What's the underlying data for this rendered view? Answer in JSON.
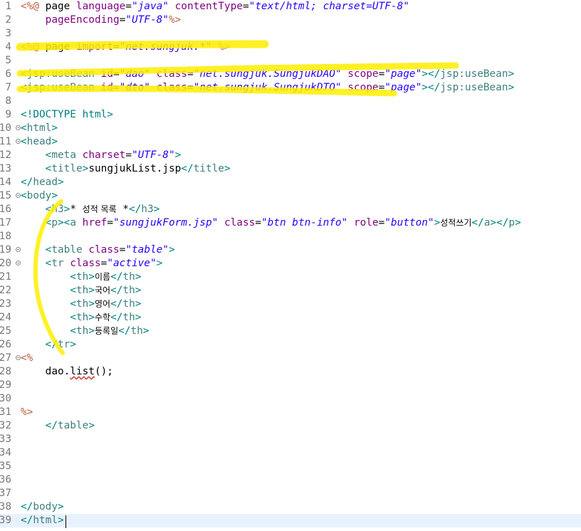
{
  "editor": {
    "current_line": 39,
    "lines": [
      {
        "num": "1",
        "fold": false,
        "tokens": [
          {
            "t": "<%@",
            "c": "jsp"
          },
          {
            "t": " page ",
            "c": "text"
          },
          {
            "t": "language",
            "c": "attr"
          },
          {
            "t": "=",
            "c": "text"
          },
          {
            "t": "\"java\"",
            "c": "val"
          },
          {
            "t": " ",
            "c": "text"
          },
          {
            "t": "contentType",
            "c": "attr"
          },
          {
            "t": "=",
            "c": "text"
          },
          {
            "t": "\"text/html; charset=UTF-8\"",
            "c": "val"
          }
        ]
      },
      {
        "num": "2",
        "fold": false,
        "tokens": [
          {
            "t": "    ",
            "c": "text"
          },
          {
            "t": "pageEncoding",
            "c": "attr"
          },
          {
            "t": "=",
            "c": "text"
          },
          {
            "t": "\"UTF-8\"",
            "c": "val"
          },
          {
            "t": "%>",
            "c": "jsp"
          }
        ]
      },
      {
        "num": "3",
        "fold": false,
        "tokens": []
      },
      {
        "num": "4",
        "fold": false,
        "tokens": [
          {
            "t": "<%@",
            "c": "jsp"
          },
          {
            "t": " page ",
            "c": "text"
          },
          {
            "t": "import",
            "c": "attr"
          },
          {
            "t": "=",
            "c": "text"
          },
          {
            "t": "\"net.sungjuk.*\"",
            "c": "val"
          },
          {
            "t": " ",
            "c": "text"
          },
          {
            "t": "%>",
            "c": "jsp"
          }
        ]
      },
      {
        "num": "5",
        "fold": false,
        "tokens": []
      },
      {
        "num": "6",
        "fold": false,
        "tokens": [
          {
            "t": "<",
            "c": "delim"
          },
          {
            "t": "jsp:useBean",
            "c": "tag"
          },
          {
            "t": " ",
            "c": "text"
          },
          {
            "t": "id",
            "c": "attr"
          },
          {
            "t": "=",
            "c": "text"
          },
          {
            "t": "\"dao\"",
            "c": "val"
          },
          {
            "t": " ",
            "c": "text"
          },
          {
            "t": "class",
            "c": "attr"
          },
          {
            "t": "=",
            "c": "text"
          },
          {
            "t": "\"net.sungjuk.SungjukDAO\"",
            "c": "val"
          },
          {
            "t": " ",
            "c": "text"
          },
          {
            "t": "scope",
            "c": "attr"
          },
          {
            "t": "=",
            "c": "text"
          },
          {
            "t": "\"page\"",
            "c": "val"
          },
          {
            "t": "></",
            "c": "delim"
          },
          {
            "t": "jsp:useBean",
            "c": "tag"
          },
          {
            "t": ">",
            "c": "delim"
          }
        ]
      },
      {
        "num": "7",
        "fold": false,
        "tokens": [
          {
            "t": "<",
            "c": "delim"
          },
          {
            "t": "jsp:useBean",
            "c": "tag"
          },
          {
            "t": " ",
            "c": "text"
          },
          {
            "t": "id",
            "c": "attr"
          },
          {
            "t": "=",
            "c": "text"
          },
          {
            "t": "\"dto\"",
            "c": "val"
          },
          {
            "t": " ",
            "c": "text"
          },
          {
            "t": "class",
            "c": "attr"
          },
          {
            "t": "=",
            "c": "text"
          },
          {
            "t": "\"net.sungjuk.SungjukDTO\"",
            "c": "val"
          },
          {
            "t": " ",
            "c": "text"
          },
          {
            "t": "scope",
            "c": "attr"
          },
          {
            "t": "=",
            "c": "text"
          },
          {
            "t": "\"page\"",
            "c": "val"
          },
          {
            "t": "></",
            "c": "delim"
          },
          {
            "t": "jsp:useBean",
            "c": "tag"
          },
          {
            "t": ">",
            "c": "delim"
          }
        ]
      },
      {
        "num": "8",
        "fold": false,
        "tokens": []
      },
      {
        "num": "9",
        "fold": false,
        "tokens": [
          {
            "t": "<!DOCTYPE html>",
            "c": "doctype"
          }
        ]
      },
      {
        "num": "10",
        "fold": true,
        "tokens": [
          {
            "t": "<",
            "c": "delim"
          },
          {
            "t": "html",
            "c": "tag"
          },
          {
            "t": ">",
            "c": "delim"
          }
        ]
      },
      {
        "num": "11",
        "fold": true,
        "tokens": [
          {
            "t": "<",
            "c": "delim"
          },
          {
            "t": "head",
            "c": "tag"
          },
          {
            "t": ">",
            "c": "delim"
          }
        ]
      },
      {
        "num": "12",
        "fold": false,
        "tokens": [
          {
            "t": "    ",
            "c": "text"
          },
          {
            "t": "<",
            "c": "delim"
          },
          {
            "t": "meta",
            "c": "tag"
          },
          {
            "t": " ",
            "c": "text"
          },
          {
            "t": "charset",
            "c": "attr"
          },
          {
            "t": "=",
            "c": "text"
          },
          {
            "t": "\"UTF-8\"",
            "c": "val"
          },
          {
            "t": ">",
            "c": "delim"
          }
        ]
      },
      {
        "num": "13",
        "fold": false,
        "tokens": [
          {
            "t": "    ",
            "c": "text"
          },
          {
            "t": "<",
            "c": "delim"
          },
          {
            "t": "title",
            "c": "tag"
          },
          {
            "t": ">",
            "c": "delim"
          },
          {
            "t": "sungjukList.jsp",
            "c": "text"
          },
          {
            "t": "</",
            "c": "delim"
          },
          {
            "t": "title",
            "c": "tag"
          },
          {
            "t": ">",
            "c": "delim"
          }
        ]
      },
      {
        "num": "14",
        "fold": false,
        "tokens": [
          {
            "t": "</",
            "c": "delim"
          },
          {
            "t": "head",
            "c": "tag"
          },
          {
            "t": ">",
            "c": "delim"
          }
        ]
      },
      {
        "num": "15",
        "fold": true,
        "tokens": [
          {
            "t": "<",
            "c": "delim"
          },
          {
            "t": "body",
            "c": "tag"
          },
          {
            "t": ">",
            "c": "delim"
          }
        ]
      },
      {
        "num": "16",
        "fold": false,
        "tokens": [
          {
            "t": "    ",
            "c": "text"
          },
          {
            "t": "<",
            "c": "delim"
          },
          {
            "t": "h3",
            "c": "tag"
          },
          {
            "t": ">",
            "c": "delim"
          },
          {
            "t": "* ",
            "c": "text"
          },
          {
            "t": "성적 목록",
            "c": "text kor"
          },
          {
            "t": " *",
            "c": "text"
          },
          {
            "t": "</",
            "c": "delim"
          },
          {
            "t": "h3",
            "c": "tag"
          },
          {
            "t": ">",
            "c": "delim"
          }
        ]
      },
      {
        "num": "17",
        "fold": false,
        "tokens": [
          {
            "t": "    ",
            "c": "text"
          },
          {
            "t": "<",
            "c": "delim"
          },
          {
            "t": "p",
            "c": "tag"
          },
          {
            "t": "><",
            "c": "delim"
          },
          {
            "t": "a",
            "c": "tag"
          },
          {
            "t": " ",
            "c": "text"
          },
          {
            "t": "href",
            "c": "attr"
          },
          {
            "t": "=",
            "c": "text"
          },
          {
            "t": "\"sungjukForm.jsp\"",
            "c": "val"
          },
          {
            "t": " ",
            "c": "text"
          },
          {
            "t": "class",
            "c": "attr"
          },
          {
            "t": "=",
            "c": "text"
          },
          {
            "t": "\"btn btn-info\"",
            "c": "val"
          },
          {
            "t": " ",
            "c": "text"
          },
          {
            "t": "role",
            "c": "attr"
          },
          {
            "t": "=",
            "c": "text"
          },
          {
            "t": "\"button\"",
            "c": "val"
          },
          {
            "t": ">",
            "c": "delim"
          },
          {
            "t": "성적쓰기",
            "c": "text kor"
          },
          {
            "t": "</",
            "c": "delim"
          },
          {
            "t": "a",
            "c": "tag"
          },
          {
            "t": "></",
            "c": "delim"
          },
          {
            "t": "p",
            "c": "tag"
          },
          {
            "t": ">",
            "c": "delim"
          }
        ]
      },
      {
        "num": "18",
        "fold": false,
        "tokens": []
      },
      {
        "num": "19",
        "fold": true,
        "tokens": [
          {
            "t": "    ",
            "c": "text"
          },
          {
            "t": "<",
            "c": "delim"
          },
          {
            "t": "table",
            "c": "tag"
          },
          {
            "t": " ",
            "c": "text"
          },
          {
            "t": "class",
            "c": "attr"
          },
          {
            "t": "=",
            "c": "text"
          },
          {
            "t": "\"table\"",
            "c": "val"
          },
          {
            "t": ">",
            "c": "delim"
          }
        ]
      },
      {
        "num": "20",
        "fold": true,
        "tokens": [
          {
            "t": "    ",
            "c": "text"
          },
          {
            "t": "<",
            "c": "delim"
          },
          {
            "t": "tr",
            "c": "tag"
          },
          {
            "t": " ",
            "c": "text"
          },
          {
            "t": "class",
            "c": "attr"
          },
          {
            "t": "=",
            "c": "text"
          },
          {
            "t": "\"active\"",
            "c": "val"
          },
          {
            "t": ">",
            "c": "delim"
          }
        ]
      },
      {
        "num": "21",
        "fold": false,
        "tokens": [
          {
            "t": "        ",
            "c": "text"
          },
          {
            "t": "<",
            "c": "delim"
          },
          {
            "t": "th",
            "c": "tag"
          },
          {
            "t": ">",
            "c": "delim"
          },
          {
            "t": "이름",
            "c": "text kor"
          },
          {
            "t": "</",
            "c": "delim"
          },
          {
            "t": "th",
            "c": "tag"
          },
          {
            "t": ">",
            "c": "delim"
          }
        ]
      },
      {
        "num": "22",
        "fold": false,
        "tokens": [
          {
            "t": "        ",
            "c": "text"
          },
          {
            "t": "<",
            "c": "delim"
          },
          {
            "t": "th",
            "c": "tag"
          },
          {
            "t": ">",
            "c": "delim"
          },
          {
            "t": "국어",
            "c": "text kor"
          },
          {
            "t": "</",
            "c": "delim"
          },
          {
            "t": "th",
            "c": "tag"
          },
          {
            "t": ">",
            "c": "delim"
          }
        ]
      },
      {
        "num": "23",
        "fold": false,
        "tokens": [
          {
            "t": "        ",
            "c": "text"
          },
          {
            "t": "<",
            "c": "delim"
          },
          {
            "t": "th",
            "c": "tag"
          },
          {
            "t": ">",
            "c": "delim"
          },
          {
            "t": "영어",
            "c": "text kor"
          },
          {
            "t": "</",
            "c": "delim"
          },
          {
            "t": "th",
            "c": "tag"
          },
          {
            "t": ">",
            "c": "delim"
          }
        ]
      },
      {
        "num": "24",
        "fold": false,
        "tokens": [
          {
            "t": "        ",
            "c": "text"
          },
          {
            "t": "<",
            "c": "delim"
          },
          {
            "t": "th",
            "c": "tag"
          },
          {
            "t": ">",
            "c": "delim"
          },
          {
            "t": "수학",
            "c": "text kor"
          },
          {
            "t": "</",
            "c": "delim"
          },
          {
            "t": "th",
            "c": "tag"
          },
          {
            "t": ">",
            "c": "delim"
          }
        ]
      },
      {
        "num": "25",
        "fold": false,
        "tokens": [
          {
            "t": "        ",
            "c": "text"
          },
          {
            "t": "<",
            "c": "delim"
          },
          {
            "t": "th",
            "c": "tag"
          },
          {
            "t": ">",
            "c": "delim"
          },
          {
            "t": "등록일",
            "c": "text kor"
          },
          {
            "t": "</",
            "c": "delim"
          },
          {
            "t": "th",
            "c": "tag"
          },
          {
            "t": ">",
            "c": "delim"
          }
        ]
      },
      {
        "num": "26",
        "fold": false,
        "tokens": [
          {
            "t": "    ",
            "c": "text"
          },
          {
            "t": "</",
            "c": "delim"
          },
          {
            "t": "tr",
            "c": "tag"
          },
          {
            "t": ">",
            "c": "delim"
          }
        ]
      },
      {
        "num": "27",
        "fold": true,
        "tokens": [
          {
            "t": "<%",
            "c": "jsp"
          }
        ]
      },
      {
        "num": "28",
        "fold": false,
        "tokens": [
          {
            "t": "    dao.",
            "c": "code"
          },
          {
            "t": "list",
            "c": "method"
          },
          {
            "t": "();",
            "c": "code"
          }
        ]
      },
      {
        "num": "29",
        "fold": false,
        "tokens": []
      },
      {
        "num": "30",
        "fold": false,
        "tokens": []
      },
      {
        "num": "31",
        "fold": false,
        "tokens": [
          {
            "t": "%>",
            "c": "jsp"
          }
        ]
      },
      {
        "num": "32",
        "fold": false,
        "tokens": [
          {
            "t": "    ",
            "c": "text"
          },
          {
            "t": "</",
            "c": "delim"
          },
          {
            "t": "table",
            "c": "tag"
          },
          {
            "t": ">",
            "c": "delim"
          }
        ]
      },
      {
        "num": "33",
        "fold": false,
        "tokens": []
      },
      {
        "num": "34",
        "fold": false,
        "tokens": []
      },
      {
        "num": "35",
        "fold": false,
        "tokens": []
      },
      {
        "num": "36",
        "fold": false,
        "tokens": []
      },
      {
        "num": "37",
        "fold": false,
        "tokens": []
      },
      {
        "num": "38",
        "fold": false,
        "tokens": [
          {
            "t": "</",
            "c": "delim"
          },
          {
            "t": "body",
            "c": "tag"
          },
          {
            "t": ">",
            "c": "delim"
          }
        ]
      },
      {
        "num": "39",
        "fold": false,
        "tokens": [
          {
            "t": "</",
            "c": "delim"
          },
          {
            "t": "html",
            "c": "tag"
          },
          {
            "t": ">",
            "c": "delim"
          }
        ]
      }
    ]
  },
  "colors": {
    "highlighter": "#ffee00",
    "current_line": "#e8f2fe",
    "line_number": "#787878"
  }
}
